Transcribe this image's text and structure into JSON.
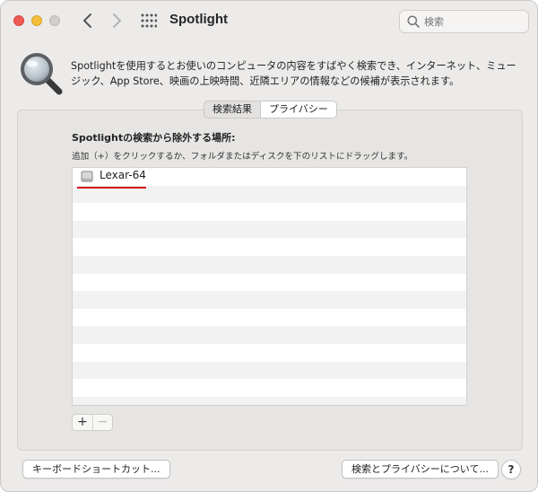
{
  "window": {
    "title": "Spotlight",
    "search_placeholder": "検索"
  },
  "header": {
    "icon": "magnifying-glass-icon",
    "description": "Spotlightを使用するとお使いのコンピュータの内容をすばやく検索でき、インターネット、ミュージック、App Store、映画の上映時間、近隣エリアの情報などの候補が表示されます。"
  },
  "tabs": [
    {
      "label": "検索結果",
      "active": false
    },
    {
      "label": "プライバシー",
      "active": true
    }
  ],
  "privacy": {
    "section_title": "Spotlightの検索から除外する場所:",
    "hint": "追加（+）をクリックするか、フォルダまたはディスクを下のリストにドラッグします。",
    "excluded_items": [
      {
        "name": "Lexar-64",
        "icon": "external-disk-icon"
      }
    ],
    "add_label": "+",
    "remove_label": "−"
  },
  "footer": {
    "keyboard_shortcuts_label": "キーボードショートカット...",
    "about_privacy_label": "検索とプライバシーについて...",
    "help_label": "?"
  },
  "colors": {
    "close": "#ee5b56",
    "minimize": "#f4bf3a",
    "annotation_underline": "#d01818"
  }
}
